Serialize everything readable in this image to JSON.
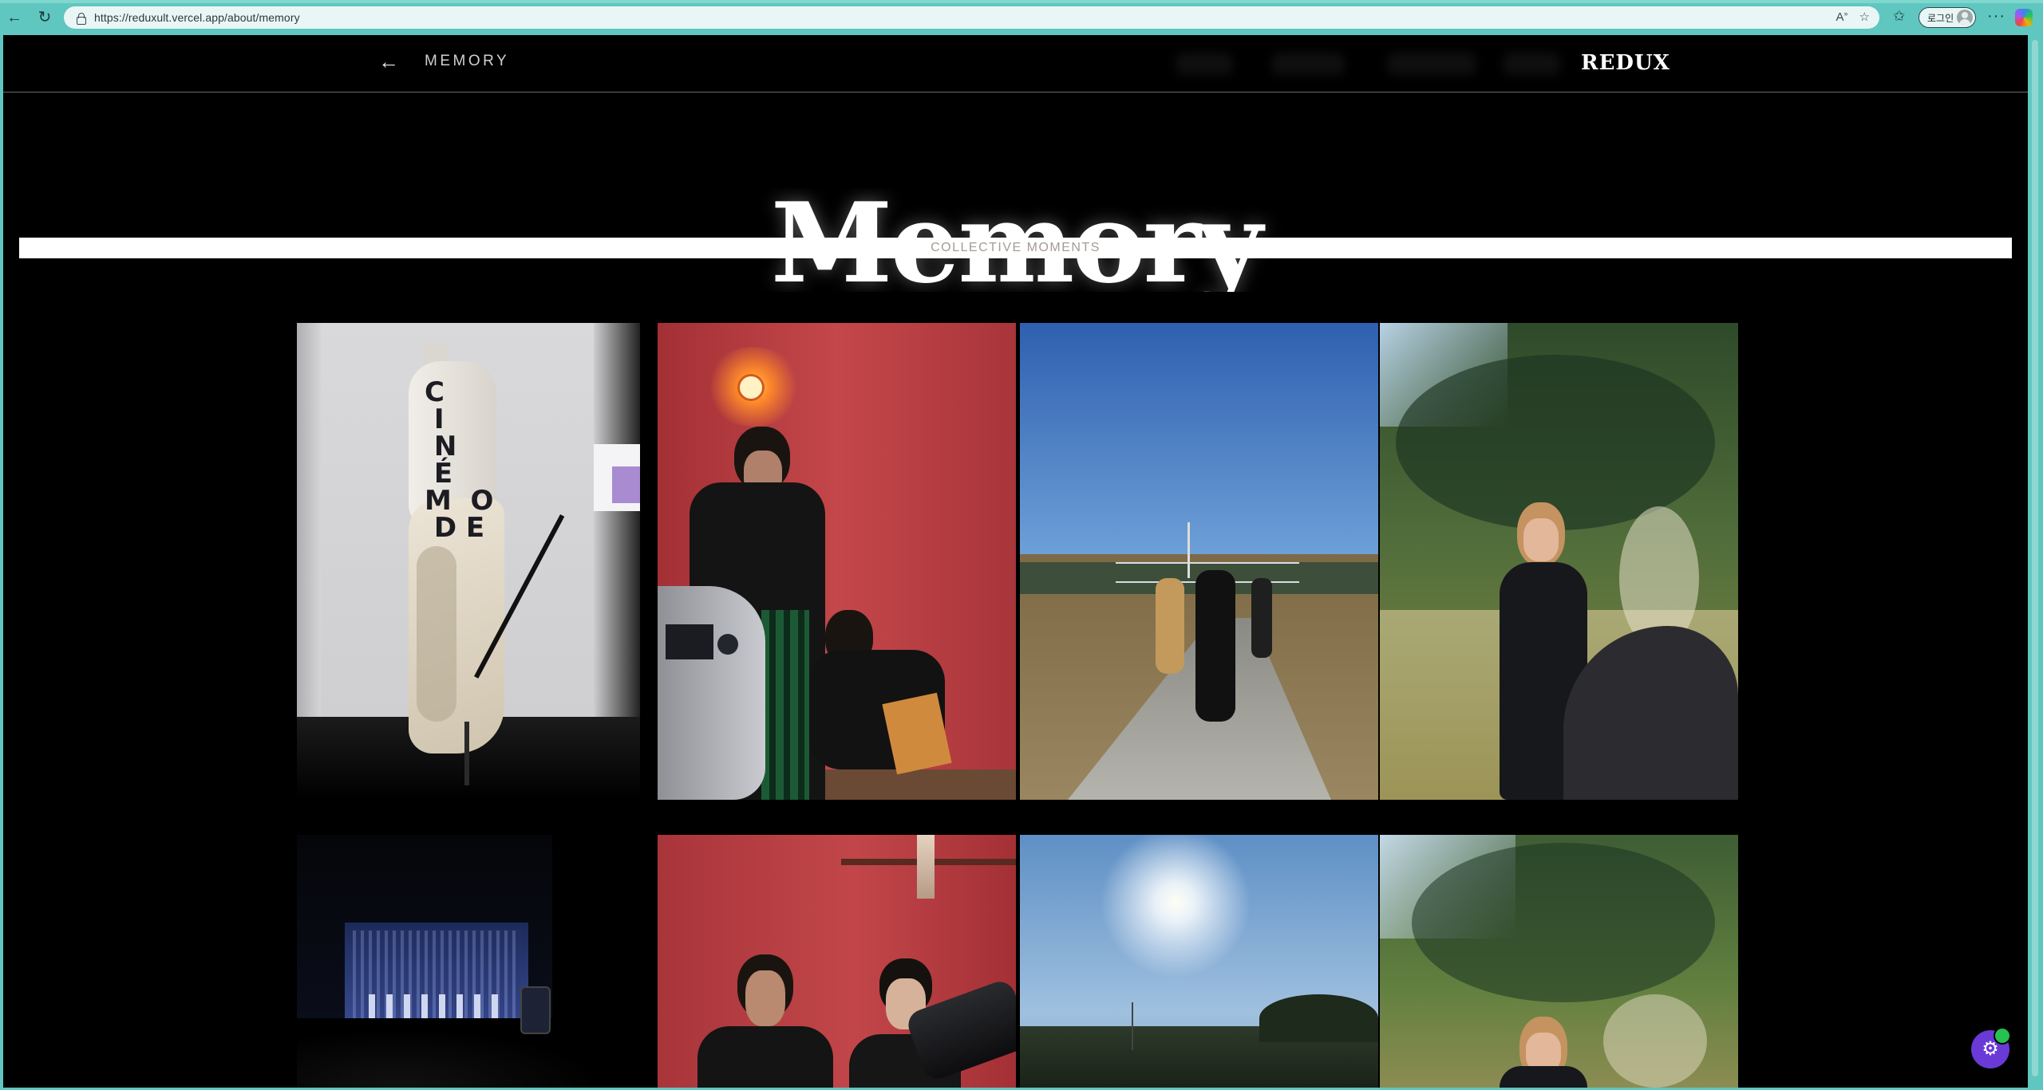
{
  "browser": {
    "url": "https://reduxult.vercel.app/about/memory",
    "login_label": "로그인",
    "back_icon": "←",
    "reload_icon": "↻",
    "more_icon": "···"
  },
  "site": {
    "back_arrow": "←",
    "page_label": "MEMORY",
    "brand": "REDUX"
  },
  "hero": {
    "title": "Memory",
    "subtitle": "COLLECTIVE MOMENTS"
  },
  "gallery": {
    "photos": [
      {
        "subject": "mannequin-dress"
      },
      {
        "subject": "red-room-models"
      },
      {
        "subject": "road-walk"
      },
      {
        "subject": "woman-in-grass"
      },
      {
        "subject": "stage-performance"
      },
      {
        "subject": "red-room-photographers"
      },
      {
        "subject": "sun-sky-field"
      },
      {
        "subject": "woman-under-pine"
      }
    ]
  },
  "fab": {
    "icon": "gear-icon"
  },
  "colors": {
    "chrome": "#5fc7c0",
    "page_bg": "#000000",
    "subtitle_band": "#ffffff",
    "subtitle_text": "#a79a94",
    "fab": "#6a3ad6"
  }
}
